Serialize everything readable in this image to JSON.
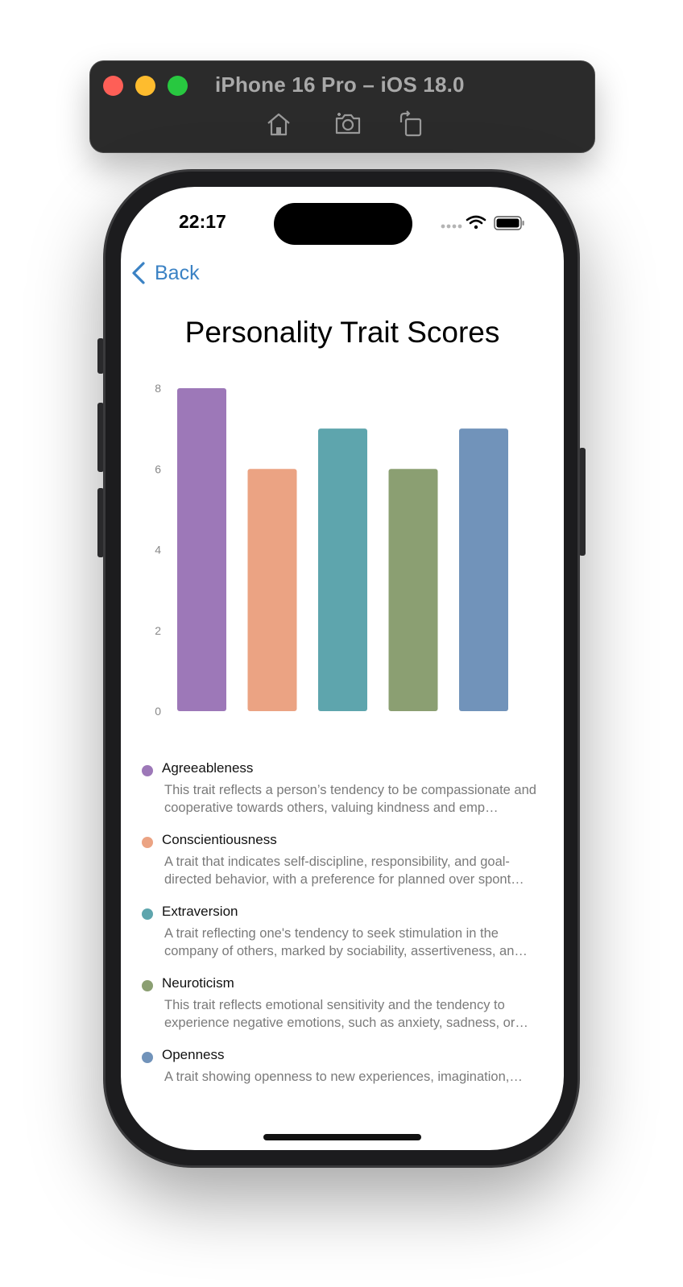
{
  "window": {
    "title": "iPhone 16 Pro – iOS 18.0",
    "toolbar_icons": [
      "home-icon",
      "screenshot-icon",
      "rotate-icon"
    ]
  },
  "status_bar": {
    "time": "22:17",
    "icons": [
      "cellular-icon",
      "wifi-icon",
      "battery-icon"
    ]
  },
  "nav": {
    "back_label": "Back",
    "accent_color": "#3b82c4"
  },
  "page": {
    "title": "Personality Trait Scores"
  },
  "chart_data": {
    "type": "bar",
    "categories": [
      "Agreeableness",
      "Conscientiousness",
      "Extraversion",
      "Neuroticism",
      "Openness"
    ],
    "values": [
      8,
      6,
      7,
      6,
      7
    ],
    "colors": [
      "#9d78b8",
      "#eba383",
      "#5ea5ad",
      "#8b9f72",
      "#7193ba"
    ],
    "yticks": [
      "0",
      "2",
      "4",
      "6",
      "8"
    ],
    "ylim": [
      0,
      8
    ],
    "title": "",
    "xlabel": "",
    "ylabel": "",
    "grid": false
  },
  "legend": {
    "items": [
      {
        "name": "Agreeableness",
        "color": "#9d78b8",
        "description": "This trait reflects a person’s tendency to be compassionate and cooperative towards others, valuing kindness and emp…"
      },
      {
        "name": "Conscientiousness",
        "color": "#eba383",
        "description": "A trait that indicates self-discipline, responsibility, and goal-directed behavior, with a preference for planned over spont…"
      },
      {
        "name": "Extraversion",
        "color": "#5ea5ad",
        "description": "A trait reflecting one's tendency to seek stimulation in the company of others, marked by sociability, assertiveness, an…"
      },
      {
        "name": "Neuroticism",
        "color": "#8b9f72",
        "description": "This trait reflects emotional sensitivity and the tendency to experience negative emotions, such as anxiety, sadness, or…"
      },
      {
        "name": "Openness",
        "color": "#7193ba",
        "description": "A trait showing openness to new experiences, imagination,…"
      }
    ]
  }
}
